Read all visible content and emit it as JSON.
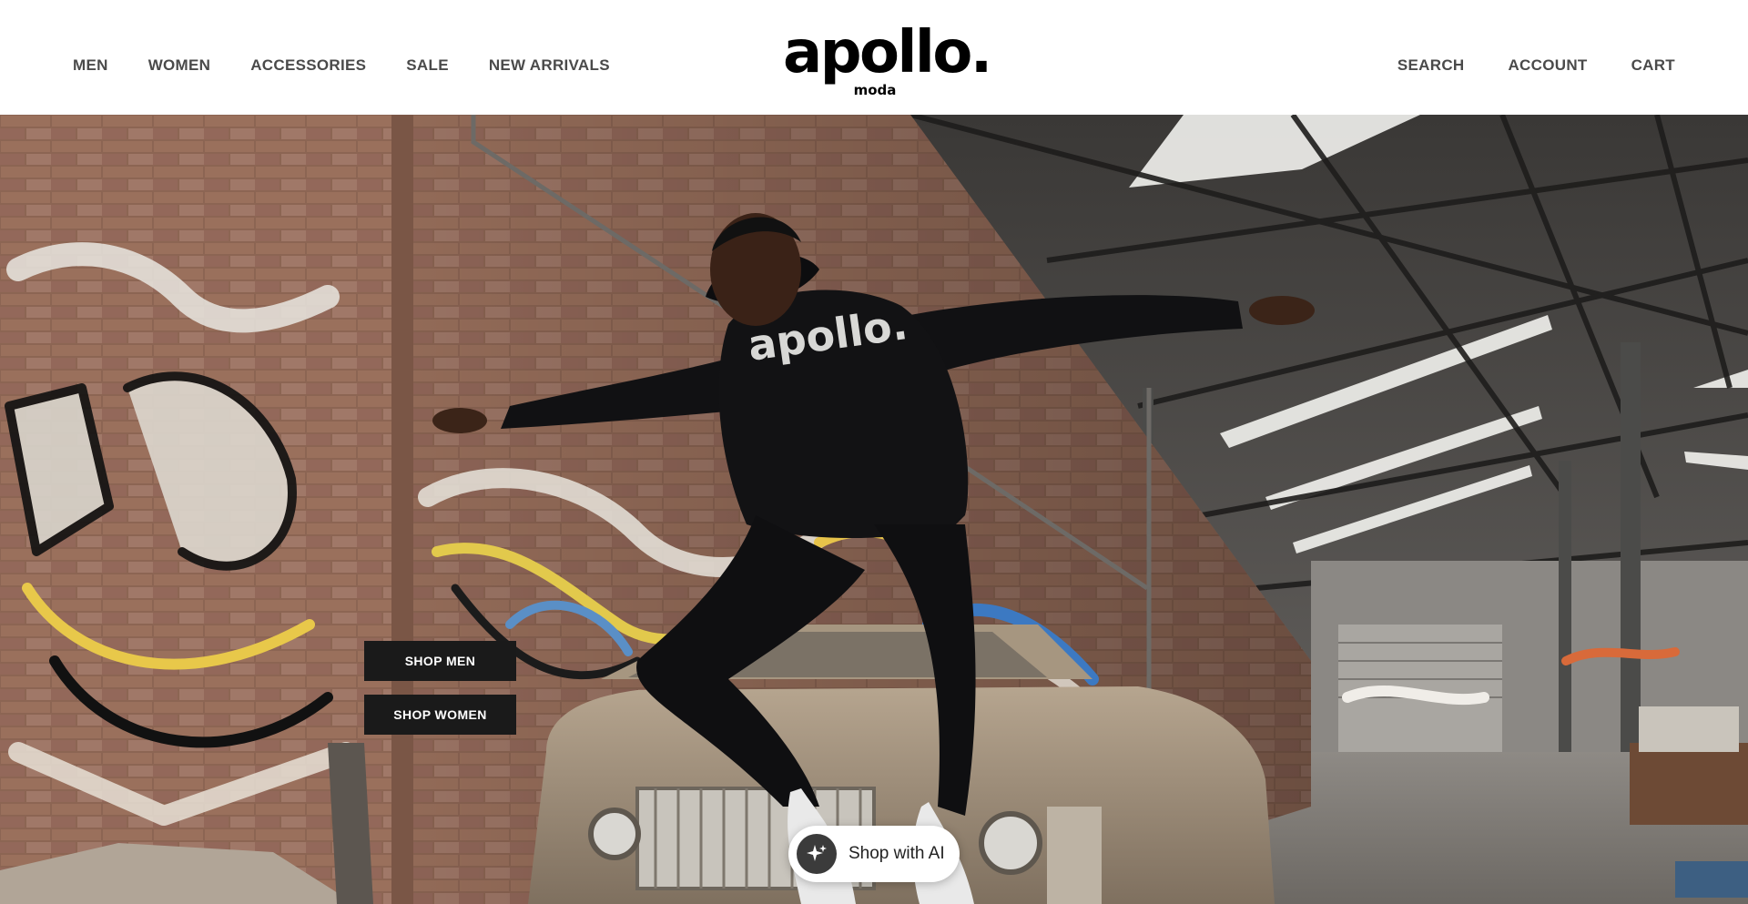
{
  "brand": {
    "logo_word": "apollo.",
    "logo_sub": "moda",
    "hoodie_print": "apollo."
  },
  "nav": {
    "left": [
      {
        "label": "MEN"
      },
      {
        "label": "WOMEN"
      },
      {
        "label": "ACCESSORIES"
      },
      {
        "label": "SALE"
      },
      {
        "label": "NEW ARRIVALS"
      }
    ],
    "right": [
      {
        "label": "SEARCH"
      },
      {
        "label": "ACCOUNT"
      },
      {
        "label": "CART"
      }
    ]
  },
  "hero": {
    "cta_men": "SHOP MEN",
    "cta_women": "SHOP WOMEN"
  },
  "assistant": {
    "label": "Shop with AI",
    "icon": "sparkle-icon"
  },
  "colors": {
    "header_bg": "#ffffff",
    "nav_text": "#4a4a4a",
    "cta_bg": "#1a1a1a",
    "cta_text": "#ffffff"
  }
}
